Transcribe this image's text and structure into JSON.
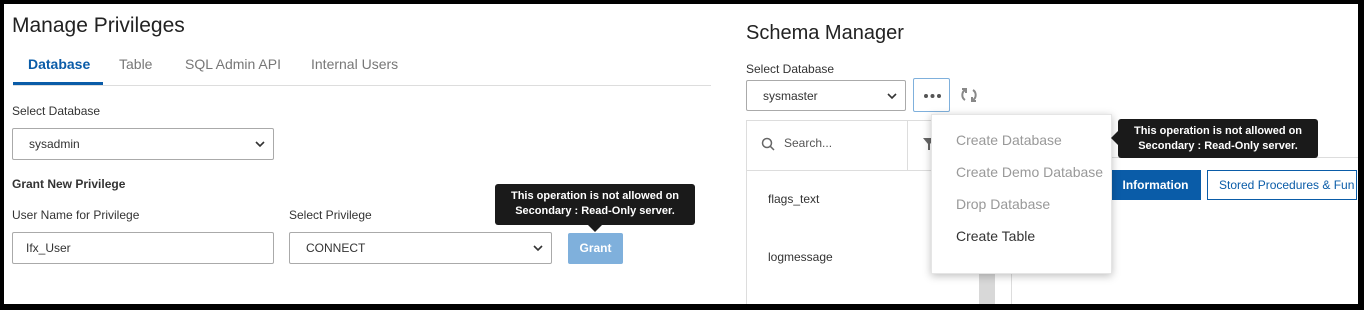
{
  "manage": {
    "title": "Manage Privileges",
    "tabs": [
      {
        "label": "Database",
        "active": true
      },
      {
        "label": "Table",
        "active": false
      },
      {
        "label": "SQL Admin API",
        "active": false
      },
      {
        "label": "Internal Users",
        "active": false
      }
    ],
    "select_db_label": "Select Database",
    "select_db_value": "sysadmin",
    "grant_heading": "Grant New Privilege",
    "user_label": "User Name for Privilege",
    "user_value": "Ifx_User",
    "priv_label": "Select Privilege",
    "priv_value": "CONNECT",
    "grant_button": "Grant",
    "tooltip_line1": "This operation is not allowed on",
    "tooltip_line2": "Secondary : Read-Only server."
  },
  "schema": {
    "title": "Schema Manager",
    "select_db_label": "Select Database",
    "select_db_value": "sysmaster",
    "search_placeholder": "Search...",
    "tables": [
      "flags_text",
      "logmessage"
    ],
    "menu": [
      {
        "label": "Create Database",
        "enabled": false
      },
      {
        "label": "Create Demo Database",
        "enabled": false
      },
      {
        "label": "Drop Database",
        "enabled": false
      },
      {
        "label": "Create Table",
        "enabled": true
      }
    ],
    "tooltip_line1": "This operation is not allowed on",
    "tooltip_line2": "Secondary : Read-Only server.",
    "info_button": "Information",
    "sp_button": "Stored Procedures & Fun"
  },
  "colors": {
    "accent": "#0a5ca8",
    "disabled_button": "#7fb0dc",
    "tooltip_bg": "#1a1a1a"
  }
}
